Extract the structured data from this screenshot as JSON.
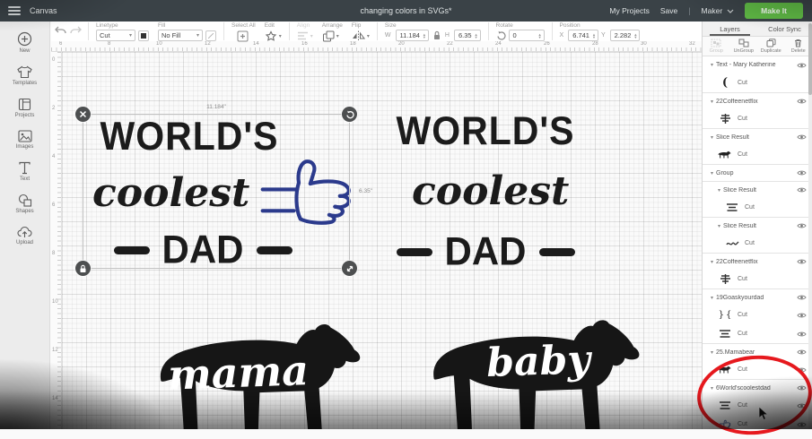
{
  "top_bar": {
    "app_title": "Canvas",
    "document_title": "changing colors in SVGs*",
    "my_projects": "My Projects",
    "save": "Save",
    "machine": "Maker",
    "make_it": "Make It"
  },
  "sidebar": {
    "items": [
      {
        "label": "New",
        "icon": "plus-circle"
      },
      {
        "label": "Templates",
        "icon": "tshirt"
      },
      {
        "label": "Projects",
        "icon": "folder"
      },
      {
        "label": "Images",
        "icon": "image"
      },
      {
        "label": "Text",
        "icon": "text"
      },
      {
        "label": "Shapes",
        "icon": "shapes"
      },
      {
        "label": "Upload",
        "icon": "upload-cloud"
      }
    ]
  },
  "toolbar": {
    "linetype_label": "Linetype",
    "linetype_value": "Cut",
    "fill_label": "Fill",
    "fill_value": "No Fill",
    "select_all": "Select All",
    "edit": "Edit",
    "align": "Align",
    "arrange": "Arrange",
    "flip": "Flip",
    "size_label": "Size",
    "w_label": "W",
    "w_value": "11.184",
    "h_label": "H",
    "h_value": "6.35",
    "rotate_label": "Rotate",
    "rotate_value": "0",
    "position_label": "Position",
    "x_label": "X",
    "x_value": "6.741",
    "y_label": "Y",
    "y_value": "2.282"
  },
  "rulers": {
    "horizontal": [
      "6",
      "8",
      "10",
      "12",
      "14",
      "16",
      "18",
      "20",
      "22",
      "24",
      "26",
      "28",
      "30",
      "32"
    ],
    "vertical": [
      "0",
      "2",
      "4",
      "6",
      "8",
      "10",
      "12",
      "14"
    ]
  },
  "canvas": {
    "selection": {
      "width_label": "11.184\"",
      "height_label": "6.35\""
    },
    "design": {
      "line1": "WORLD'S",
      "line2": "coolest",
      "line3": "DAD"
    },
    "bears": [
      {
        "text": "mama"
      },
      {
        "text": "baby"
      }
    ],
    "accent_blue": "#2b3a8c",
    "ink": "#1b1b1b"
  },
  "layers_panel": {
    "tabs": [
      {
        "label": "Layers"
      },
      {
        "label": "Color Sync"
      }
    ],
    "actions": [
      {
        "label": "Group",
        "disabled": true
      },
      {
        "label": "UnGroup",
        "disabled": false
      },
      {
        "label": "Duplicate",
        "disabled": false
      },
      {
        "label": "Delete",
        "disabled": false
      }
    ],
    "rows": [
      {
        "kind": "header",
        "label": "Text - Mary Katherine",
        "eye": true,
        "sep": false
      },
      {
        "kind": "child",
        "label": "Cut",
        "thumb": "paren",
        "eye": false
      },
      {
        "kind": "header",
        "label": "22Coffeenetflix",
        "eye": true,
        "sep": true
      },
      {
        "kind": "child",
        "label": "Cut",
        "thumb": "stamp",
        "eye": false
      },
      {
        "kind": "header",
        "label": "Slice Result",
        "eye": true,
        "sep": true
      },
      {
        "kind": "child",
        "label": "Cut",
        "thumb": "bear",
        "eye": false
      },
      {
        "kind": "header",
        "label": "Group",
        "eye": true,
        "sep": true
      },
      {
        "kind": "sub",
        "label": "Slice Result",
        "eye": true,
        "sep": true
      },
      {
        "kind": "child2",
        "label": "Cut",
        "thumb": "textlines",
        "eye": false
      },
      {
        "kind": "sub",
        "label": "Slice Result",
        "eye": true,
        "sep": true
      },
      {
        "kind": "child2",
        "label": "Cut",
        "thumb": "script",
        "eye": false
      },
      {
        "kind": "header",
        "label": "22Coffeenetflix",
        "eye": true,
        "sep": true
      },
      {
        "kind": "child",
        "label": "Cut",
        "thumb": "stamp",
        "eye": false
      },
      {
        "kind": "header",
        "label": "19Goaskyourdad",
        "eye": true,
        "sep": true
      },
      {
        "kind": "child",
        "label": "Cut",
        "thumb": "braces",
        "eye": true
      },
      {
        "kind": "child",
        "label": "Cut",
        "thumb": "textlines",
        "eye": true
      },
      {
        "kind": "header",
        "label": "25.Mamabear",
        "eye": true,
        "sep": true
      },
      {
        "kind": "child",
        "label": "Cut",
        "thumb": "bear",
        "eye": true
      },
      {
        "kind": "header",
        "label": "6World'scoolestdad",
        "eye": true,
        "sep": true
      },
      {
        "kind": "child",
        "label": "Cut",
        "thumb": "textlines",
        "eye": true
      },
      {
        "kind": "child",
        "label": "Cut",
        "thumb": "thumbsup",
        "eye": true
      }
    ]
  },
  "annotation": {
    "circle_color": "#e6191e"
  }
}
